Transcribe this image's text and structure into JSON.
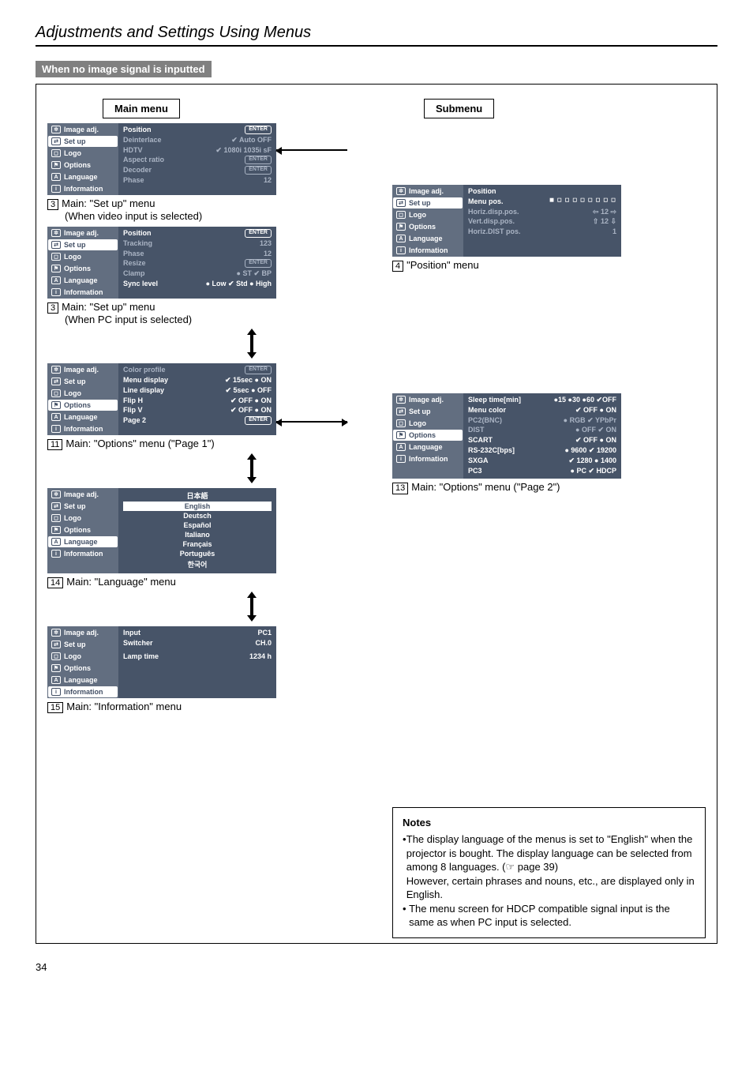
{
  "section_title": "Adjustments and Settings Using Menus",
  "sub_bar": "When no image signal is inputted",
  "labels": {
    "main_menu": "Main menu",
    "submenu": "Submenu"
  },
  "tabs": {
    "image": "Image adj.",
    "setup": "Set up",
    "logo": "Logo",
    "options": "Options",
    "language": "Language",
    "information": "Information"
  },
  "menus": {
    "setup_video": {
      "rows": [
        {
          "k": "Position",
          "v": "ENTER",
          "pill": true,
          "khl": true,
          "vhl": true
        },
        {
          "k": "Deinterlace",
          "v": "✔ Auto    OFF"
        },
        {
          "k": "HDTV",
          "v": "✔ 1080i    1035i    sF"
        },
        {
          "k": "Aspect ratio",
          "v": "ENTER",
          "pill": true
        },
        {
          "k": "Decoder",
          "v": "ENTER",
          "pill": true
        },
        {
          "k": "Phase",
          "v": "12"
        }
      ],
      "caption_num": "3",
      "caption": "Main: \"Set up\" menu",
      "caption2": "(When video input is selected)"
    },
    "setup_pc": {
      "rows": [
        {
          "k": "Position",
          "v": "ENTER",
          "pill": true,
          "khl": true,
          "vhl": true
        },
        {
          "k": "Tracking",
          "v": "123"
        },
        {
          "k": "Phase",
          "v": "12"
        },
        {
          "k": "Resize",
          "v": "ENTER",
          "pill": true
        },
        {
          "k": "Clamp",
          "v": "● ST  ✔ BP"
        },
        {
          "k": "Sync level",
          "v": "● Low ✔ Std  ● High",
          "khl": true,
          "vhl": true
        }
      ],
      "caption_num": "3",
      "caption": "Main: \"Set up\" menu",
      "caption2": "(When PC input is selected)"
    },
    "options1": {
      "rows": [
        {
          "k": "Color profile",
          "v": "ENTER",
          "pill": true
        },
        {
          "k": "Menu display",
          "v": "✔ 15sec   ● ON",
          "khl": true,
          "vhl": true
        },
        {
          "k": "Line display",
          "v": "✔ 5sec    ● OFF",
          "khl": true,
          "vhl": true
        },
        {
          "k": "Flip H",
          "v": "✔ OFF   ● ON",
          "khl": true,
          "vhl": true
        },
        {
          "k": "Flip V",
          "v": "✔ OFF   ● ON",
          "khl": true,
          "vhl": true
        },
        {
          "k": "Page 2",
          "v": "ENTER",
          "pill": true,
          "khl": true,
          "vhl": true
        }
      ],
      "caption_num": "11",
      "caption": "Main: \"Options\" menu (\"Page 1\")"
    },
    "language_menu": {
      "items": [
        "日本語",
        "English",
        "Deutsch",
        "Español",
        "Italiano",
        "Français",
        "Português",
        "한국어"
      ],
      "selected": 1,
      "caption_num": "14",
      "caption": "Main: \"Language\" menu"
    },
    "information": {
      "rows": [
        {
          "k": "Input",
          "v": "PC1",
          "khl": true,
          "vhl": true
        },
        {
          "k": "Switcher",
          "v": "CH.0",
          "khl": true,
          "vhl": true
        },
        {
          "k": "",
          "v": ""
        },
        {
          "k": "",
          "v": ""
        },
        {
          "k": "Lamp time",
          "v": "1234 h",
          "khl": true,
          "vhl": true
        }
      ],
      "caption_num": "15",
      "caption": "Main: \"Information\" menu"
    },
    "position_sub": {
      "rows": [
        {
          "k": "Position",
          "khl": true
        },
        {
          "k": "Menu pos.",
          "v": "◼ ◻ ◻ ◻ ◻ ◻ ◻ ◻ ◻",
          "khl": true,
          "vhl": true,
          "icons": true
        },
        {
          "k": "Horiz.disp.pos.",
          "v": "⇦   12   ⇨"
        },
        {
          "k": "Vert.disp.pos.",
          "v": "⇧   12   ⇩"
        },
        {
          "k": "Horiz.DIST pos.",
          "v": "1"
        }
      ],
      "caption_num": "4",
      "caption": "\"Position\" menu"
    },
    "options2": {
      "rows": [
        {
          "k": "Sleep time[min]",
          "v": "●15 ●30 ●60 ✔OFF",
          "khl": true,
          "vhl": true
        },
        {
          "k": "Menu color",
          "v": "✔ OFF   ● ON",
          "khl": true,
          "vhl": true
        },
        {
          "k": "PC2(BNC)",
          "v": "● RGB  ✔ YPbPr"
        },
        {
          "k": "DIST",
          "v": "● OFF  ✔ ON"
        },
        {
          "k": "SCART",
          "v": "✔ OFF   ● ON",
          "khl": true,
          "vhl": true
        },
        {
          "k": "RS-232C[bps]",
          "v": "● 9600  ✔ 19200",
          "khl": true,
          "vhl": true
        },
        {
          "k": "SXGA",
          "v": "✔ 1280  ● 1400",
          "khl": true,
          "vhl": true
        },
        {
          "k": "PC3",
          "v": "● PC   ✔ HDCP",
          "khl": true,
          "vhl": true
        }
      ],
      "caption_num": "13",
      "caption": "Main: \"Options\" menu (\"Page 2\")"
    }
  },
  "notes": {
    "heading": "Notes",
    "b1": "The display language of the menus is set to \"English\" when the projector is bought. The display language can be selected from among 8 languages. (☞ page 39)",
    "b1b": "However, certain phrases and nouns, etc., are displayed only in English.",
    "b2": "The menu screen for HDCP compatible signal input is the same as when PC input is selected."
  },
  "page_number": "34"
}
